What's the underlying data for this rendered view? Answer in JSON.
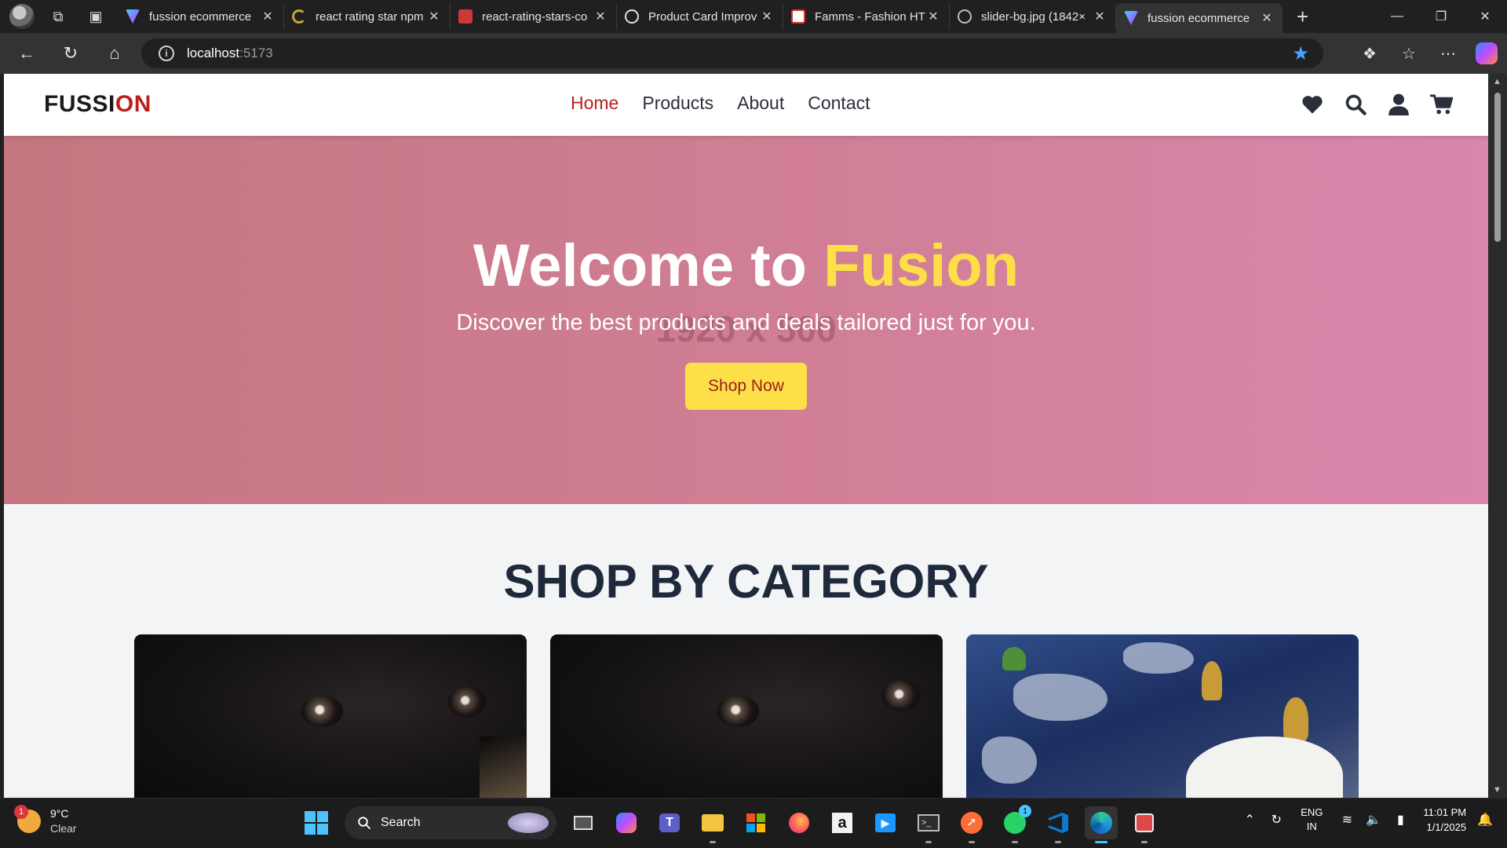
{
  "browser": {
    "tabs": [
      {
        "title": "fussion ecommerce",
        "favicon": "vite-icon",
        "active": false
      },
      {
        "title": "react rating star npm",
        "favicon": "loading-icon",
        "active": false
      },
      {
        "title": "react-rating-stars-co",
        "favicon": "npm-icon",
        "active": false
      },
      {
        "title": "Product Card Improv",
        "favicon": "chatgpt-icon",
        "active": false
      },
      {
        "title": "Famms - Fashion HT",
        "favicon": "famms-icon",
        "active": false
      },
      {
        "title": "slider-bg.jpg (1842×",
        "favicon": "globe-icon",
        "active": false
      },
      {
        "title": "fussion ecommerce",
        "favicon": "vite-icon",
        "active": true
      }
    ],
    "address": {
      "host": "localhost",
      "port": ":5173"
    }
  },
  "site": {
    "logo": {
      "main": "FUSSI",
      "accent": "ON"
    },
    "menu": [
      {
        "label": "Home",
        "active": true
      },
      {
        "label": "Products",
        "active": false
      },
      {
        "label": "About",
        "active": false
      },
      {
        "label": "Contact",
        "active": false
      }
    ],
    "icons": [
      "heart-icon",
      "search-icon",
      "user-icon",
      "cart-icon"
    ],
    "hero": {
      "title_main": "Welcome to ",
      "title_accent": "Fusion",
      "subtitle": "Discover the best products and deals tailored just for you.",
      "placeholder_text": "1920 x 500",
      "button": "Shop Now"
    },
    "category_section": {
      "title": "SHOP BY CATEGORY"
    },
    "colors": {
      "accent": "#b8211c",
      "highlight": "#fde047",
      "heading": "#1e293b"
    }
  },
  "taskbar": {
    "weather": {
      "temp": "9°C",
      "condition": "Clear",
      "badge": "1"
    },
    "search_label": "Search",
    "whatsapp_badge": "1",
    "lang": {
      "line1": "ENG",
      "line2": "IN"
    },
    "clock": {
      "time": "11:01 PM",
      "date": "1/1/2025"
    }
  }
}
